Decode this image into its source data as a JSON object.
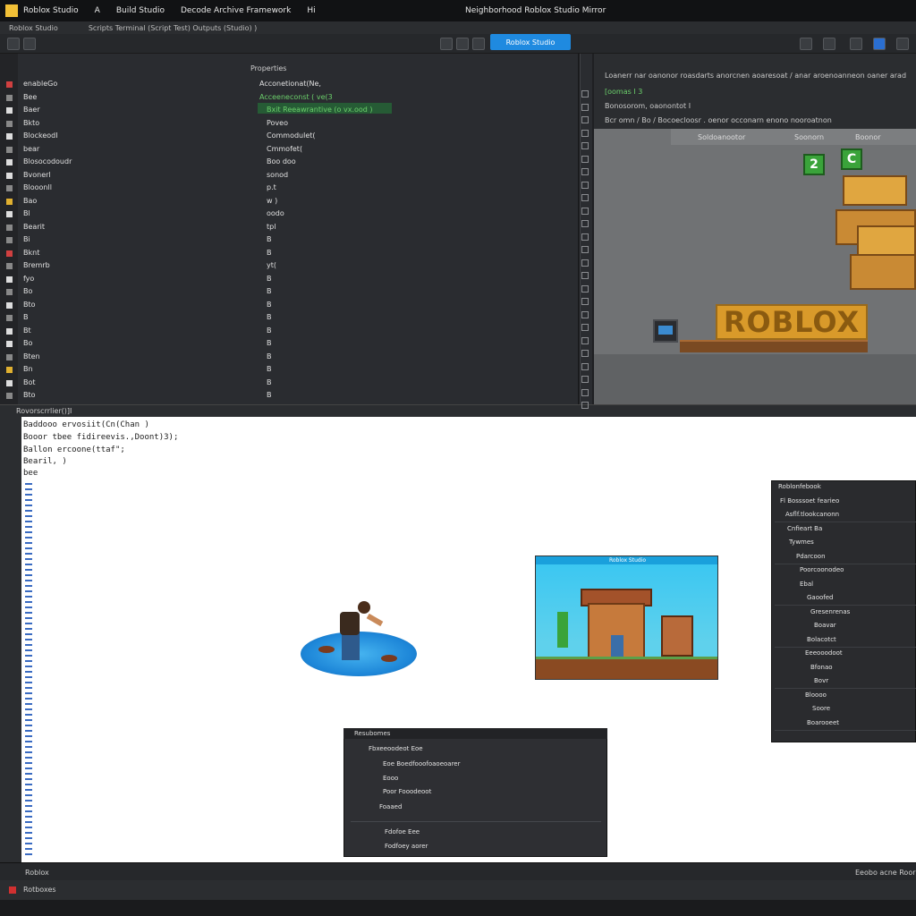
{
  "menubar": {
    "items": [
      "Roblox Studio",
      "A",
      "Build Studio",
      "Decode Archive Framework",
      "Hi"
    ],
    "window_title": "Neighborhood Roblox Studio Mirror"
  },
  "tabs": {
    "items": [
      "Roblox Studio",
      "Scripts Terminal (Script Test) Outputs (Studio) )"
    ]
  },
  "toolbar": {
    "test_button": "Roblox Studio"
  },
  "explorer": {
    "title": "Properties",
    "rows": [
      {
        "name": "enableGo",
        "value": "Acconetionat(Ne,"
      },
      {
        "name": "Bee",
        "value": "Acceeneconst ( ve(3"
      },
      {
        "name": "Baer",
        "value": "Bxit Reeawrantive (o vx.ood )"
      },
      {
        "name": "Bkto",
        "value": "Poveo"
      },
      {
        "name": "BlockeodI",
        "value": "Commodulet("
      },
      {
        "name": "bear",
        "value": "Cmmofet("
      },
      {
        "name": "Blosocodoudr",
        "value": "Boo doo"
      },
      {
        "name": "Bvonerl",
        "value": "sonod"
      },
      {
        "name": "Blooonll",
        "value": "p.t"
      },
      {
        "name": "Bao",
        "value": "w )"
      },
      {
        "name": "Bl",
        "value": "oodo"
      },
      {
        "name": "Bearit",
        "value": "tpl"
      },
      {
        "name": "Bi",
        "value": "B"
      },
      {
        "name": "Bknt",
        "value": "B"
      },
      {
        "name": "Bremrb",
        "value": "yt("
      },
      {
        "name": "fyo",
        "value": "B"
      },
      {
        "name": "Bo",
        "value": "B"
      },
      {
        "name": "Bto",
        "value": "B"
      },
      {
        "name": "B",
        "value": "B"
      },
      {
        "name": "Bt",
        "value": "B"
      },
      {
        "name": "Bo",
        "value": "B"
      },
      {
        "name": "Bten",
        "value": "B"
      },
      {
        "name": "Bn",
        "value": "B"
      },
      {
        "name": "Bot",
        "value": "B"
      },
      {
        "name": "Bto",
        "value": "B"
      }
    ]
  },
  "viewport_header": {
    "lines": [
      "Loanerr nar oanonor roasdarts anorcnen aoaresoat / anar aroenoanneon oaner arad",
      "[oomas I 3",
      "Bonosorom, oaonontot I",
      "Bcr omn / Bo / Bocoecloosr . oenor occonarn enono nooroatnon"
    ],
    "sub": [
      "Soldoanootor",
      "Soonorn",
      "Boonor"
    ]
  },
  "viewport": {
    "logo_text": "ROBLOX",
    "block_letters": [
      "2",
      "C"
    ]
  },
  "separator": {
    "label": "Rovorscrrlier()]I"
  },
  "code": {
    "lines": [
      "Baddooo ervosiit(Cn(Chan )",
      "Booor tbee fidireevis.,Doont)3);",
      "Ballon ercoone(ttaf\";",
      "Bearil,  )",
      "bee"
    ]
  },
  "preview": {
    "title": "Roblox Studio"
  },
  "hierarchy": {
    "items": [
      "Roblonfebook",
      "Fl Bosssoet fearieo",
      "Asflf.tlookcanonn",
      "Cnfieart Ba",
      "Tywmes",
      "Pdarcoon",
      "Poorcoonodeo",
      "Ebal",
      "Gaoofed",
      "Gresenrenas",
      "Boavar",
      "Bolacotct",
      "Eeeooodoot",
      "Bfonao",
      "Bovr",
      "Bloooo",
      "Soore",
      "Boarooeet"
    ]
  },
  "context_menu": {
    "header": "Resubomes",
    "items": [
      "Fbxeeoodeot Eoe",
      "Eoe Boedfooofoaoeoarer",
      "Eooo",
      "Poor Fooodeoot",
      "Foaaed",
      "Fdofoe Eee",
      "Fodfoey aorer"
    ]
  },
  "statusbar": {
    "left": "Roblox",
    "right": "Eeobo acne Roor"
  },
  "outputbar": {
    "label": "Rotboxes"
  },
  "colors": {
    "accent": "#1f8ae0",
    "panel": "#2a2c30",
    "editor_bg": "#ffffff",
    "highlight_green": "#265b35",
    "block_gold": "#d99a2a"
  }
}
